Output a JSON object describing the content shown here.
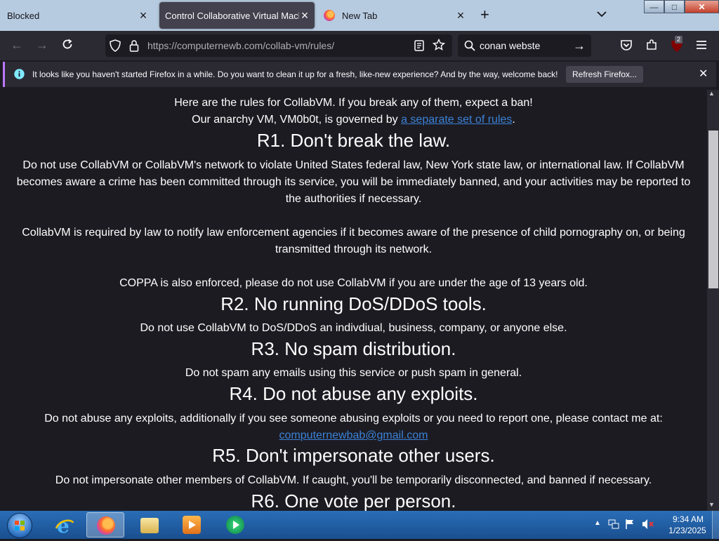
{
  "tabs": [
    {
      "label": "Blocked"
    },
    {
      "label": "Control Collaborative Virtual Machine"
    },
    {
      "label": "New Tab"
    }
  ],
  "window_controls": {
    "minimize": "—",
    "maximize": "□",
    "close": "✕"
  },
  "navbar": {
    "url_host": "https://computernewb.com",
    "url_path": "/collab-vm/rules/",
    "search_value": "conan webste",
    "extension_badge": "2"
  },
  "notification": {
    "text": "It looks like you haven't started Firefox in a while. Do you want to clean it up for a fresh, like-new experience? And by the way, welcome back!",
    "button": "Refresh Firefox..."
  },
  "page": {
    "intro_line1": "Here are the rules for CollabVM. If you break any of them, expect a ban!",
    "intro_line2_pre": "Our anarchy VM, VM0b0t, is governed by ",
    "intro_link": "a separate set of rules",
    "intro_line2_post": ".",
    "r1_title": "R1. Don't break the law.",
    "r1_p1": "Do not use CollabVM or CollabVM's network to violate United States federal law, New York state law, or international law. If CollabVM becomes aware a crime has been committed through its service, you will be immediately banned, and your activities may be reported to the authorities if necessary.",
    "r1_p2": "CollabVM is required by law to notify law enforcement agencies if it becomes aware of the presence of child pornography on, or being transmitted through its network.",
    "r1_p3": "COPPA is also enforced, please do not use CollabVM if you are under the age of 13 years old.",
    "r2_title": "R2. No running DoS/DDoS tools.",
    "r2_p": "Do not use CollabVM to DoS/DDoS an indivdiual, business, company, or anyone else.",
    "r3_title": "R3. No spam distribution.",
    "r3_p": "Do not spam any emails using this service or push spam in general.",
    "r4_title": "R4. Do not abuse any exploits.",
    "r4_p": "Do not abuse any exploits, additionally if you see someone abusing exploits or you need to report one, please contact me at:",
    "r4_email": "computernewbab@gmail.com",
    "r5_title": "R5. Don't impersonate other users.",
    "r5_p": "Do not impersonate other members of CollabVM. If caught, you'll be temporarily disconnected, and banned if necessary.",
    "r6_title": "R6. One vote per person."
  },
  "taskbar": {
    "items": [
      "start-orb",
      "internet-explorer-icon",
      "firefox-icon",
      "file-explorer-icon",
      "media-player-icon",
      "media-center-icon"
    ],
    "time": "9:34 AM",
    "date": "1/23/2025"
  },
  "colors": {
    "accent_link": "#3b82d6",
    "page_bg": "#1c1b22",
    "notif_accent": "#bd78ff"
  }
}
